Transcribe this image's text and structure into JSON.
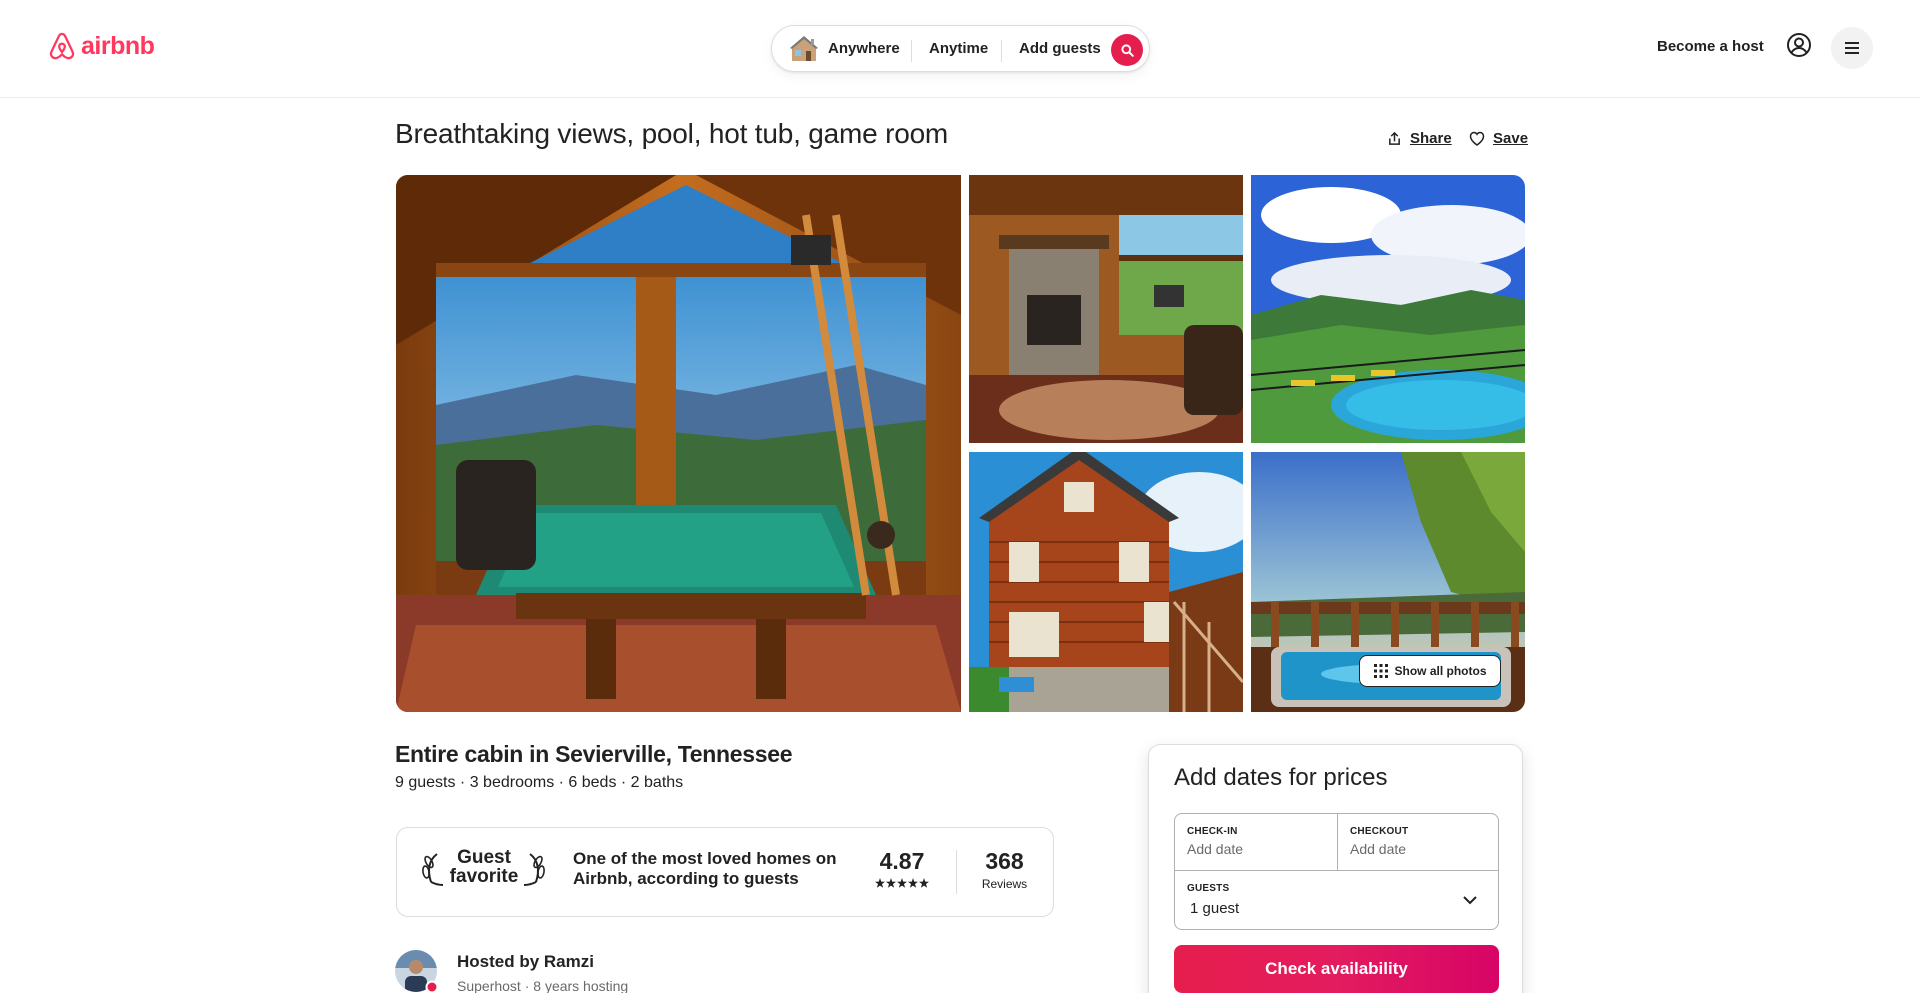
{
  "header": {
    "logo_text": "airbnb",
    "brand_color": "#ff385c",
    "search": {
      "anywhere": "Anywhere",
      "anytime": "Anytime",
      "add_guests": "Add guests",
      "search_icon": "search-icon",
      "accent_color": "#e61e4d"
    },
    "become_host": "Become a host",
    "globe_icon": "user-circle-icon",
    "menu_icon": "hamburger-icon"
  },
  "listing": {
    "title": "Breathtaking views, pool, hot tub, game room",
    "share_label": "Share",
    "save_label": "Save",
    "show_all_photos": "Show all photos",
    "subtitle": "Entire cabin in Sevierville, Tennessee",
    "details": "9 guests · 3 bedrooms · 6 beds · 2 baths"
  },
  "guest_favorite": {
    "badge_line1": "Guest",
    "badge_line2": "favorite",
    "description": "One of the most loved homes on Airbnb, according to guests",
    "rating": "4.87",
    "stars": 5,
    "reviews_count": "368",
    "reviews_label": "Reviews"
  },
  "host": {
    "name_line": "Hosted by Ramzi",
    "meta": "Superhost · 8 years hosting"
  },
  "booking": {
    "title": "Add dates for prices",
    "checkin_label": "CHECK-IN",
    "checkin_value": "Add date",
    "checkout_label": "CHECKOUT",
    "checkout_value": "Add date",
    "guests_label": "GUESTS",
    "guests_value": "1 guest",
    "button_label": "Check availability"
  }
}
